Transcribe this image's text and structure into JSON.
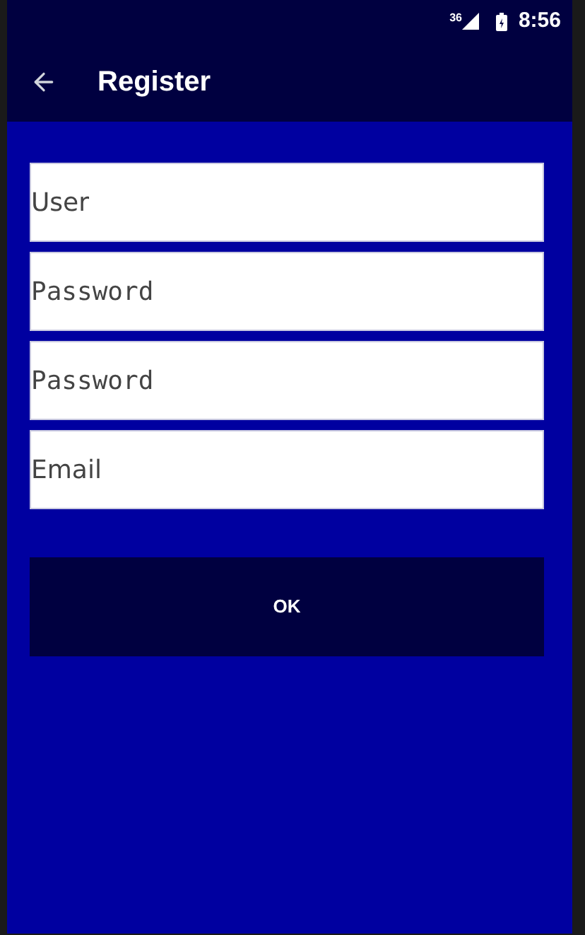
{
  "status_bar": {
    "network": "36",
    "time": "8:56"
  },
  "app_bar": {
    "title": "Register"
  },
  "fields": [
    {
      "kind": "text",
      "placeholder": "User"
    },
    {
      "kind": "password",
      "placeholder": "Password"
    },
    {
      "kind": "password",
      "placeholder": "Password"
    },
    {
      "kind": "email",
      "placeholder": "Email"
    }
  ],
  "button": {
    "label": "OK"
  }
}
